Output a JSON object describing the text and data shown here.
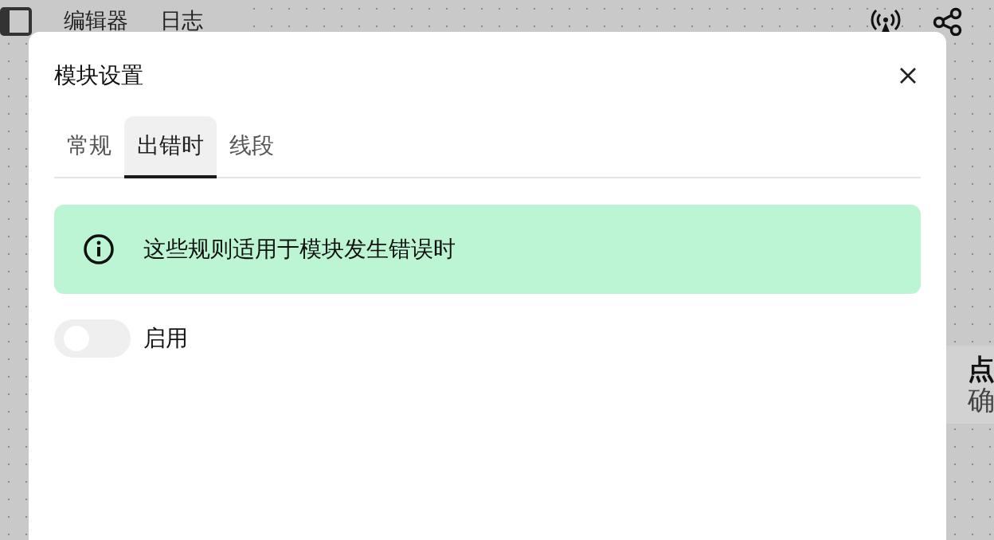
{
  "topbar": {
    "tabs": [
      "编辑器",
      "日志"
    ]
  },
  "background_card": {
    "title": "点",
    "subtitle": "确"
  },
  "dialog": {
    "title": "模块设置",
    "tabs": [
      {
        "label": "常规",
        "selected": false
      },
      {
        "label": "出错时",
        "selected": true
      },
      {
        "label": "线段",
        "selected": false
      }
    ],
    "notice": {
      "text": "这些规则适用于模块发生错误时"
    },
    "toggle": {
      "label": "启用",
      "on": false
    }
  }
}
